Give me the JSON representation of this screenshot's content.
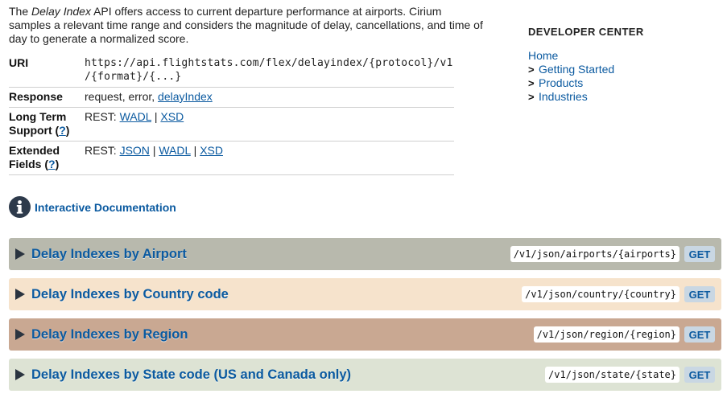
{
  "intro": {
    "prefix": "The ",
    "api_name": "Delay Index",
    "text": " API offers access to current departure performance at airports. Cirium samples a relevant time range and considers the magnitude of delay, cancellations, and time of day to generate a normalized score."
  },
  "spec": {
    "uri_label": "URI",
    "uri_line1": "https://api.flightstats.com/flex/delayindex/{protocol}/v1",
    "uri_line2": "/{format}/{...}",
    "response_label": "Response",
    "response_text": "request, error, ",
    "response_link": "delayIndex",
    "lts_label_1": "Long Term",
    "lts_label_2": "Support (",
    "lts_label_q": "?",
    "lts_label_end": ")",
    "lts_rest": "REST: ",
    "lts_links": [
      "WADL",
      "XSD"
    ],
    "ext_label_1": "Extended",
    "ext_label_2": "Fields (",
    "ext_label_q": "?",
    "ext_label_end": ")",
    "ext_rest": "REST: ",
    "ext_links": [
      "JSON",
      "WADL",
      "XSD"
    ],
    "sep": "|"
  },
  "developer_center": {
    "heading": "DEVELOPER CENTER",
    "home": "Home",
    "arrow": ">",
    "items": [
      "Getting Started",
      "Products",
      "Industries"
    ]
  },
  "interactive_doc": {
    "title": "Interactive Documentation"
  },
  "sections": [
    {
      "title": "Delay Indexes by Airport",
      "path": "/v1/json/airports/{airports}",
      "verb": "GET",
      "color": "#b8b9ad"
    },
    {
      "title": "Delay Indexes by Country code",
      "path": "/v1/json/country/{country}",
      "verb": "GET",
      "color": "#f6e3cc"
    },
    {
      "title": "Delay Indexes by Region",
      "path": "/v1/json/region/{region}",
      "verb": "GET",
      "color": "#c9a892"
    },
    {
      "title": "Delay Indexes by State code (US and Canada only)",
      "path": "/v1/json/state/{state}",
      "verb": "GET",
      "color": "#dde3d4"
    }
  ]
}
